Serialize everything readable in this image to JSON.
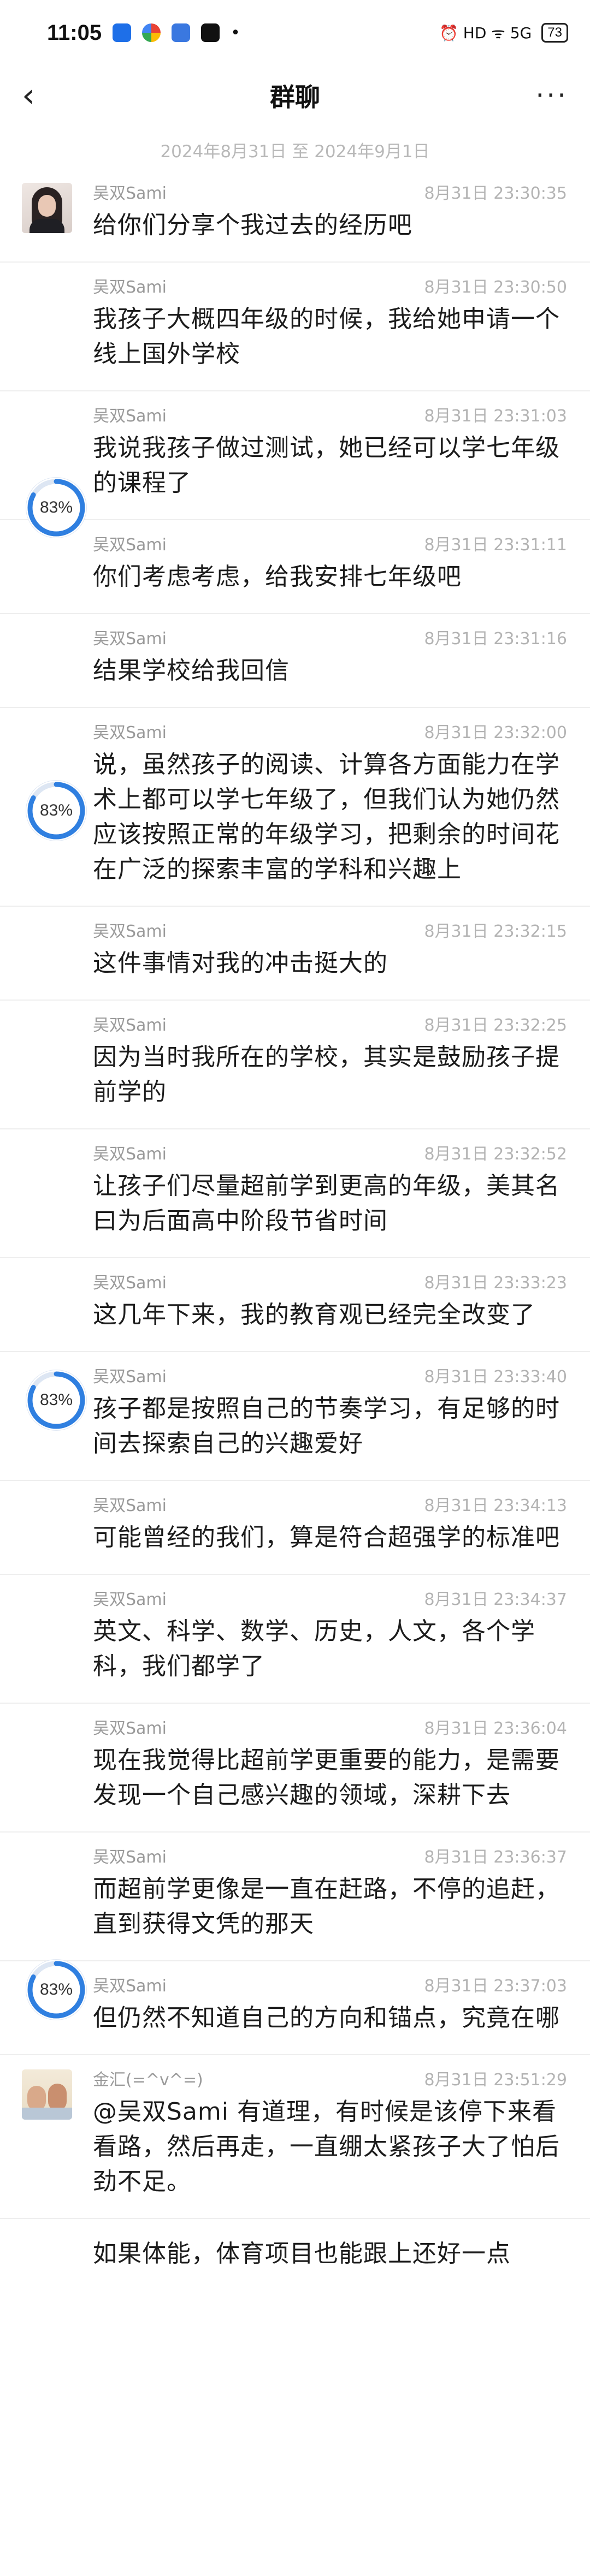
{
  "status_bar": {
    "time": "11:05",
    "right_icons": "⏰ HD ᯤ 5G",
    "battery": "73"
  },
  "nav": {
    "title": "群聊",
    "more": "···"
  },
  "date_range": "2024年8月31日 至 2024年9月1日",
  "progress_badge_label": "83%",
  "messages": [
    {
      "sender": "吴双Sami",
      "time": "8月31日 23:30:35",
      "text": "给你们分享个我过去的经历吧"
    },
    {
      "sender": "吴双Sami",
      "time": "8月31日 23:30:50",
      "text": "我孩子大概四年级的时候，我给她申请一个线上国外学校"
    },
    {
      "sender": "吴双Sami",
      "time": "8月31日 23:31:03",
      "text": "我说我孩子做过测试，她已经可以学七年级的课程了"
    },
    {
      "sender": "吴双Sami",
      "time": "8月31日 23:31:11",
      "text": "你们考虑考虑，给我安排七年级吧"
    },
    {
      "sender": "吴双Sami",
      "time": "8月31日 23:31:16",
      "text": "结果学校给我回信"
    },
    {
      "sender": "吴双Sami",
      "time": "8月31日 23:32:00",
      "text": "说，虽然孩子的阅读、计算各方面能力在学术上都可以学七年级了，但我们认为她仍然应该按照正常的年级学习，把剩余的时间花在广泛的探索丰富的学科和兴趣上"
    },
    {
      "sender": "吴双Sami",
      "time": "8月31日 23:32:15",
      "text": "这件事情对我的冲击挺大的"
    },
    {
      "sender": "吴双Sami",
      "time": "8月31日 23:32:25",
      "text": "因为当时我所在的学校，其实是鼓励孩子提前学的"
    },
    {
      "sender": "吴双Sami",
      "time": "8月31日 23:32:52",
      "text": "让孩子们尽量超前学到更高的年级，美其名曰为后面高中阶段节省时间"
    },
    {
      "sender": "吴双Sami",
      "time": "8月31日 23:33:23",
      "text": "这几年下来，我的教育观已经完全改变了"
    },
    {
      "sender": "吴双Sami",
      "time": "8月31日 23:33:40",
      "text": "孩子都是按照自己的节奏学习，有足够的时间去探索自己的兴趣爱好"
    },
    {
      "sender": "吴双Sami",
      "time": "8月31日 23:34:13",
      "text": "可能曾经的我们，算是符合超强学的标准吧"
    },
    {
      "sender": "吴双Sami",
      "time": "8月31日 23:34:37",
      "text": "英文、科学、数学、历史，人文，各个学科，我们都学了"
    },
    {
      "sender": "吴双Sami",
      "time": "8月31日 23:36:04",
      "text": "现在我觉得比超前学更重要的能力，是需要发现一个自己感兴趣的领域，深耕下去"
    },
    {
      "sender": "吴双Sami",
      "time": "8月31日 23:36:37",
      "text": "而超前学更像是一直在赶路，不停的追赶，直到获得文凭的那天"
    },
    {
      "sender": "吴双Sami",
      "time": "8月31日 23:37:03",
      "text": "但仍然不知道自己的方向和锚点，究竟在哪"
    },
    {
      "sender": "金汇(=^v^=)",
      "time": "8月31日 23:51:29",
      "text": "@吴双Sami 有道理，有时候是该停下来看看路，然后再走，一直绷太紧孩子大了怕后劲不足。"
    },
    {
      "sender": "",
      "time": "",
      "text": "如果体能，体育项目也能跟上还好一点"
    }
  ]
}
